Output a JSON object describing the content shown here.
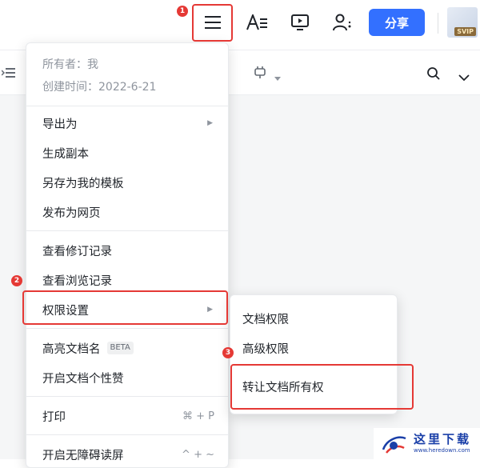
{
  "topbar": {
    "share_label": "分享",
    "svip_label": "SVIP",
    "icons": [
      "menu-icon",
      "text-format-icon",
      "presentation-icon",
      "collaborator-icon"
    ]
  },
  "annotations": {
    "step1": "1",
    "step2": "2",
    "step3": "3",
    "highlight_color": "#e53935"
  },
  "menu": {
    "owner": "所有者：我",
    "created": "创建时间：2022-6-21",
    "items": {
      "export": "导出为",
      "duplicate": "生成副本",
      "save_template": "另存为我的模板",
      "publish_web": "发布为网页",
      "revision_history": "查看修订记录",
      "view_history": "查看浏览记录",
      "permissions": "权限设置",
      "highlight_name": "高亮文档名",
      "beta": "BETA",
      "like": "开启文档个性赞",
      "print": "打印",
      "print_shortcut": "⌘ + P",
      "accessibility": "开启无障碍读屏",
      "accessibility_shortcut": "^ + ~"
    }
  },
  "submenu": {
    "doc_permissions": "文档权限",
    "advanced_permissions": "高级权限",
    "transfer_ownership": "转让文档所有权"
  },
  "watermark": {
    "text": "这里下载",
    "url": "www.heredown.com"
  },
  "colors": {
    "accent": "#3370ff",
    "text": "#1f2329",
    "muted": "#8f959e"
  }
}
